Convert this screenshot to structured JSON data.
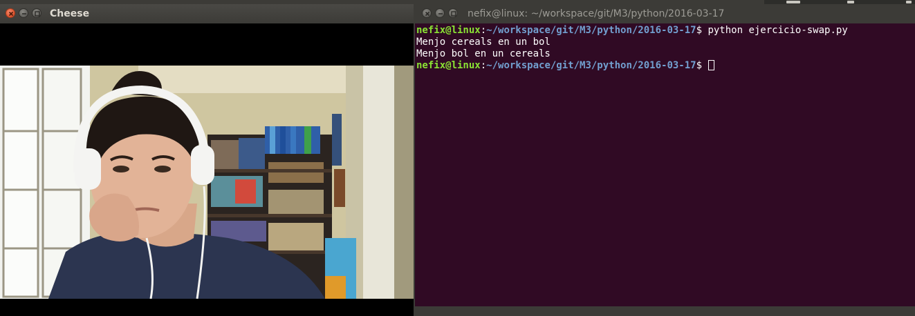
{
  "cheese": {
    "title": "Cheese",
    "buttons": {
      "close": "close-icon",
      "minimize": "minimize-icon",
      "maximize": "maximize-icon"
    },
    "colors": {
      "close": "#e05a36",
      "title_text": "#dfdbd2"
    }
  },
  "terminal": {
    "title": "nefix@linux: ~/workspace/git/M3/python/2016-03-17",
    "colors": {
      "background": "#300a24",
      "user": "#8ae234",
      "path": "#729fcf",
      "text": "#ffffff"
    },
    "lines": [
      {
        "user": "nefix@linux",
        "sep": ":",
        "path": "~/workspace/git/M3/python/2016-03-17",
        "prompt": "$ ",
        "cmd": "python ejercicio-swap.py"
      },
      {
        "text": "Menjo cereals en un bol"
      },
      {
        "text": "Menjo bol en un cereals"
      },
      {
        "user": "nefix@linux",
        "sep": ":",
        "path": "~/workspace/git/M3/python/2016-03-17",
        "prompt": "$ ",
        "cmd": ""
      }
    ]
  }
}
